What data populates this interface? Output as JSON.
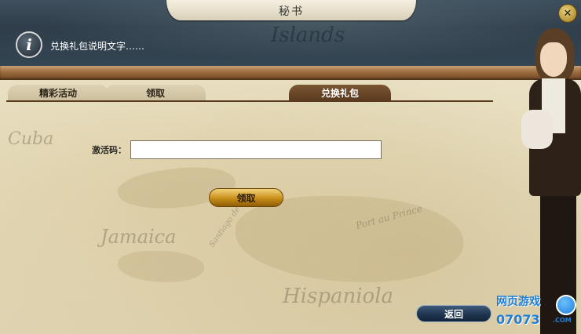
{
  "window": {
    "title": "秘书"
  },
  "info": {
    "text": "兑换礼包说明文字……"
  },
  "map": {
    "labels": [
      "Islands",
      "Cuba",
      "Jamaica",
      "Hispaniola",
      "Port au Prince",
      "Santiago de Cuba"
    ]
  },
  "tabs": [
    {
      "label": "精彩活动",
      "active": false
    },
    {
      "label": "领取",
      "active": false
    },
    {
      "label": "兑换礼包",
      "active": true
    }
  ],
  "form": {
    "code_label": "激活码：",
    "code_value": "",
    "claim_button": "领取"
  },
  "footer": {
    "back_button": "返回"
  },
  "watermark": {
    "cn": "网页游戏",
    "num": "07073",
    "com": ".COM"
  },
  "colors": {
    "header_bg": "#2f3e4a",
    "tab_active": "#5b3b20",
    "claim_button": "#c88e18",
    "back_button": "#1f3550"
  },
  "icons": {
    "info": "info-icon",
    "close": "close-icon"
  }
}
